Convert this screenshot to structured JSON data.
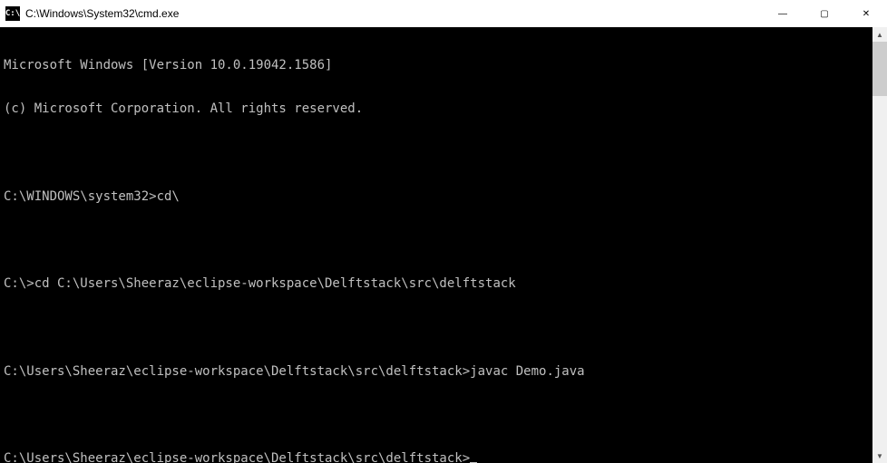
{
  "titlebar": {
    "icon_label": "C:\\",
    "title": "C:\\Windows\\System32\\cmd.exe"
  },
  "window_controls": {
    "minimize": "—",
    "maximize": "▢",
    "close": "✕"
  },
  "terminal": {
    "lines": [
      "Microsoft Windows [Version 10.0.19042.1586]",
      "(c) Microsoft Corporation. All rights reserved.",
      "",
      "C:\\WINDOWS\\system32>cd\\",
      "",
      "C:\\>cd C:\\Users\\Sheeraz\\eclipse-workspace\\Delftstack\\src\\delftstack",
      "",
      "C:\\Users\\Sheeraz\\eclipse-workspace\\Delftstack\\src\\delftstack>javac Demo.java",
      "",
      "C:\\Users\\Sheeraz\\eclipse-workspace\\Delftstack\\src\\delftstack>"
    ]
  },
  "scrollbar": {
    "up": "▲",
    "down": "▼"
  }
}
